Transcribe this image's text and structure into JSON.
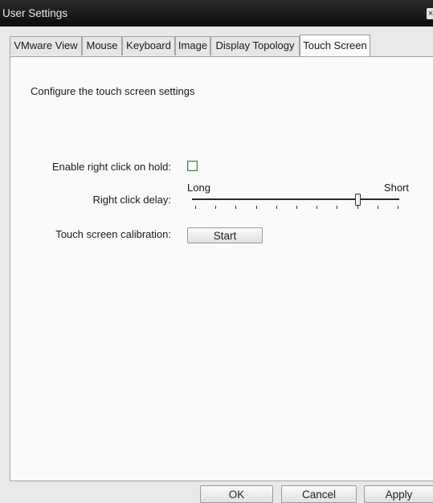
{
  "window": {
    "title": "User Settings",
    "close_glyph": "×"
  },
  "tabs": [
    {
      "label": "VMware View"
    },
    {
      "label": "Mouse"
    },
    {
      "label": "Keyboard"
    },
    {
      "label": "Image"
    },
    {
      "label": "Display Topology"
    },
    {
      "label": "Touch Screen"
    }
  ],
  "active_tab": "Touch Screen",
  "touch": {
    "description": "Configure the touch screen settings",
    "right_click_label": "Enable right click on hold:",
    "right_click_enabled": false,
    "delay_label": "Right click delay:",
    "delay_min_label": "Long",
    "delay_max_label": "Short",
    "delay_value_fraction": 0.8,
    "delay_tick_count": 11,
    "calibration_label": "Touch screen calibration:",
    "calibration_button": "Start"
  },
  "footer": {
    "ok": "OK",
    "cancel": "Cancel",
    "apply": "Apply"
  },
  "icons": {
    "close": "close-icon",
    "checkbox": "checkbox-unchecked",
    "slider_thumb": "slider-thumb"
  }
}
